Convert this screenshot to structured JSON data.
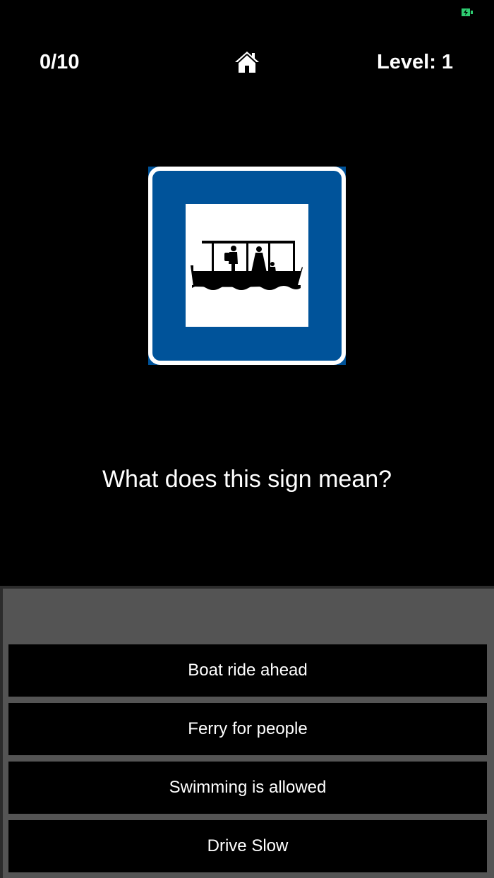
{
  "status_bar": {
    "battery_icon": "battery-charging-icon",
    "battery_color": "#2ecc71"
  },
  "header": {
    "score": "0/10",
    "home_icon": "home-icon",
    "level_label": "Level:",
    "level_value": "1"
  },
  "sign": {
    "icon": "ferry-sign-icon",
    "border_color": "#00539a",
    "inner_color": "#ffffff"
  },
  "question": "What does this sign mean?",
  "answers": [
    {
      "label": "Boat ride ahead"
    },
    {
      "label": "Ferry for people"
    },
    {
      "label": "Swimming is allowed"
    },
    {
      "label": "Drive Slow"
    }
  ]
}
